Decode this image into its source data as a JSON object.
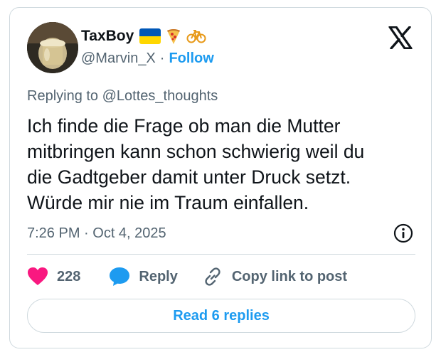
{
  "author": {
    "display_name": "TaxBoy",
    "handle": "@Marvin_X",
    "separator": "·",
    "follow_label": "Follow",
    "avatar_icon": "avatar-photo-glass",
    "badges": [
      "ukraine-flag-icon",
      "pizza-icon",
      "bicycle-icon"
    ]
  },
  "platform_logo": "x-logo-icon",
  "reply_context": {
    "prefix": "Replying to",
    "target": "@Lottes_thoughts"
  },
  "tweet": {
    "lines": [
      "Ich finde die Frage ob man die Mutter",
      "mitbringen kann schon schwierig weil du",
      "die Gadtgeber damit unter Druck setzt.",
      "Würde mir nie im Traum einfallen."
    ],
    "timestamp": "7:26 PM · Oct 4, 2025"
  },
  "actions": {
    "like_count": "228",
    "reply_label": "Reply",
    "copy_label": "Copy link to post"
  },
  "footer": {
    "read_replies_label": "Read 6 replies"
  },
  "colors": {
    "accent": "#1d9bf0",
    "like": "#f91880",
    "secondary_text": "#536471",
    "border": "#cfd9de"
  }
}
